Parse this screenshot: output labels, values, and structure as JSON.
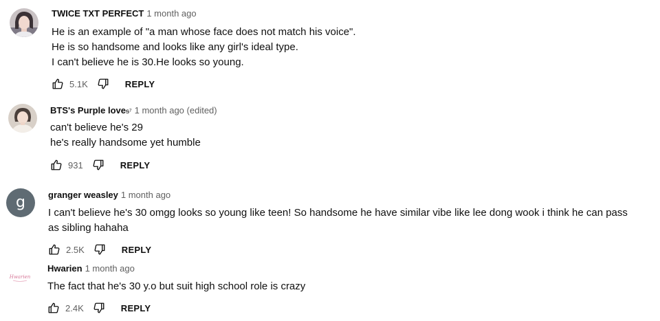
{
  "comments": [
    {
      "author": "TWICE TXT PERFECT",
      "time": "1 month ago",
      "lines": [
        "He is an example of \"a man whose face does not match his voice\".",
        "He is so handsome and looks like any girl's ideal type.",
        "I can't believe he is 30.He looks so young."
      ],
      "likes": "5.1K",
      "reply_label": "REPLY",
      "avatar_icon": "photo-avatar"
    },
    {
      "author": "BTS's Purple love",
      "author_suffix": "ᵴ⁷",
      "time": "1 month ago (edited)",
      "lines": [
        "can't believe he's 29",
        "he's really handsome yet humble"
      ],
      "likes": "931",
      "reply_label": "REPLY",
      "avatar_icon": "photo-avatar"
    },
    {
      "author": "granger weasley",
      "time": "1 month ago",
      "lines": [
        "I can't believe he's 30 omgg looks so young like teen! So handsome he have similar vibe like lee dong wook i think he can pass",
        "as sibling hahaha"
      ],
      "likes": "2.5K",
      "reply_label": "REPLY",
      "avatar_letter": "g",
      "avatar_color": "#5f6b73"
    },
    {
      "author": "Hwarien",
      "time": "1 month ago",
      "lines": [
        "The fact that he's 30 y.o but suit high school role is crazy"
      ],
      "likes": "2.4K",
      "reply_label": "REPLY",
      "avatar_icon": "logo-avatar",
      "avatar_logo_text": "Hwarien"
    }
  ],
  "colors": {
    "text_primary": "#0f0f0f",
    "text_secondary": "#606060",
    "background": "#ffffff"
  },
  "icons": {
    "like": "thumbs-up-icon",
    "dislike": "thumbs-down-icon"
  }
}
